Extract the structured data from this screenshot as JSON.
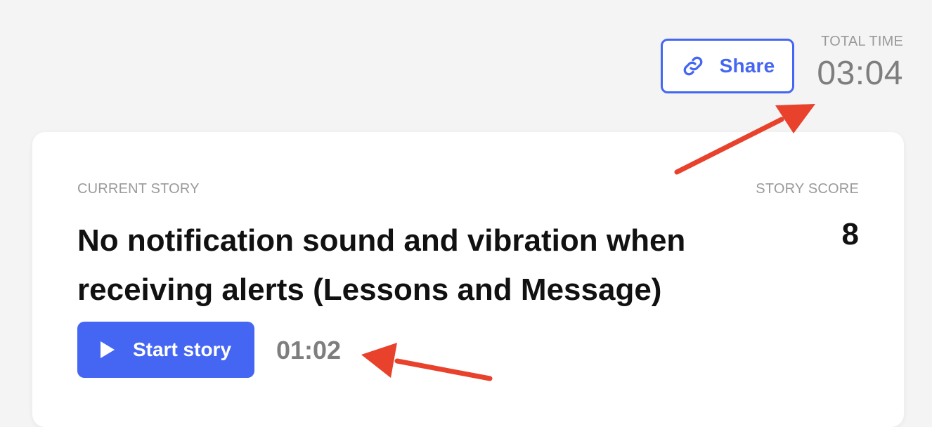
{
  "header": {
    "share_label": "Share",
    "share_icon": "link-icon",
    "total_time_label": "TOTAL TIME",
    "total_time_value": "03:04"
  },
  "story": {
    "current_story_label": "CURRENT STORY",
    "title": "No notification sound and vibration when receiving alerts (Lessons and Message)",
    "score_label": "STORY SCORE",
    "score_value": "8",
    "start_label": "Start story",
    "start_icon": "play-icon",
    "timer_value": "01:02"
  },
  "colors": {
    "accent": "#4466f2",
    "annotation": "#e8412c"
  }
}
